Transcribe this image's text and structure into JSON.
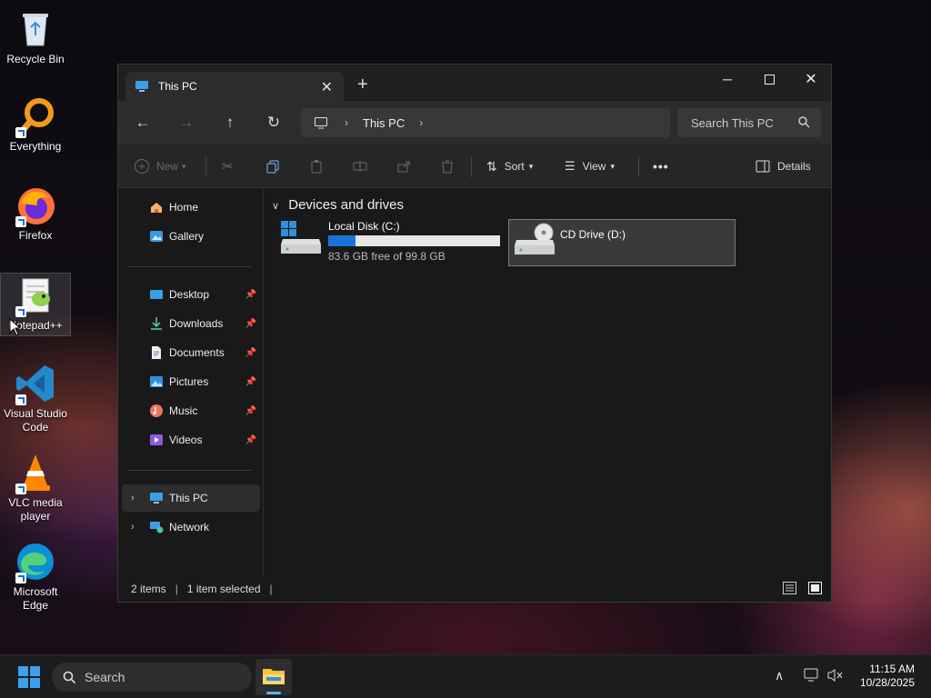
{
  "desktop": {
    "icons": [
      {
        "label": "Recycle Bin"
      },
      {
        "label": "Everything"
      },
      {
        "label": "Firefox"
      },
      {
        "label": "Notepad++"
      },
      {
        "label": "Visual Studio Code"
      },
      {
        "label": "VLC media player"
      },
      {
        "label": "Microsoft Edge"
      }
    ]
  },
  "window": {
    "tab_title": "This PC",
    "address": {
      "crumb": "This PC"
    },
    "search_placeholder": "Search This PC",
    "commands": {
      "new_label": "New",
      "sort_label": "Sort",
      "view_label": "View",
      "more_label": "•••",
      "details_label": "Details"
    },
    "sidebar": {
      "top": [
        {
          "label": "Home"
        },
        {
          "label": "Gallery"
        }
      ],
      "pinned": [
        {
          "label": "Desktop"
        },
        {
          "label": "Downloads"
        },
        {
          "label": "Documents"
        },
        {
          "label": "Pictures"
        },
        {
          "label": "Music"
        },
        {
          "label": "Videos"
        }
      ],
      "bottom": [
        {
          "label": "This PC"
        },
        {
          "label": "Network"
        }
      ]
    },
    "content": {
      "section_title": "Devices and drives",
      "drives": [
        {
          "name": "Local Disk (C:)",
          "free_text": "83.6 GB free of 99.8 GB",
          "used_fraction": 0.16
        },
        {
          "name": "CD Drive (D:)"
        }
      ]
    },
    "status": {
      "items": "2 items",
      "selected": "1 item selected"
    }
  },
  "taskbar": {
    "search_label": "Search",
    "time": "11:15 AM",
    "date": "10/28/2025"
  },
  "colors": {
    "accent": "#1a73d9",
    "window_bg": "#191919"
  }
}
